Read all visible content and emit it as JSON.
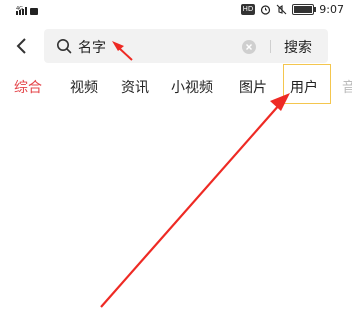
{
  "status_bar": {
    "signal": "4G",
    "time": "9:07",
    "battery": "100",
    "hd": "HD"
  },
  "header": {
    "search_value": "名字",
    "search_button_label": "搜索"
  },
  "tabs": [
    {
      "label": "综合",
      "active": true
    },
    {
      "label": "视频",
      "active": false
    },
    {
      "label": "资讯",
      "active": false
    },
    {
      "label": "小视频",
      "active": false
    },
    {
      "label": "图片",
      "active": false
    },
    {
      "label": "用户",
      "active": false
    },
    {
      "label": "音",
      "active": false
    }
  ],
  "colors": {
    "active_tab": "#e4454a",
    "highlight_box": "#f4c64e",
    "annotation_arrow": "#ee2a24"
  },
  "icons": {
    "back": "chevron-left-icon",
    "search": "search-icon",
    "clear": "clear-icon"
  }
}
